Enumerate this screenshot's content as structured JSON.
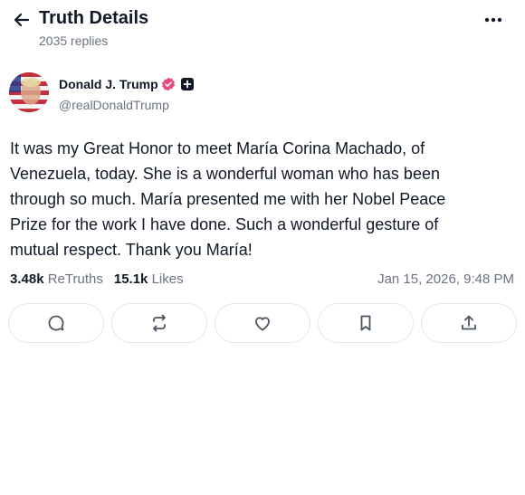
{
  "header": {
    "title": "Truth Details",
    "replies_label": "2035 replies"
  },
  "post": {
    "author": {
      "name": "Donald J. Trump",
      "handle": "@realDonaldTrump"
    },
    "text_lines": [
      "It was my Great Honor to meet María Corina Machado, of",
      "Venezuela, today. She is a wonderful woman who has been",
      "through so much. María presented me with her Nobel Peace",
      "Prize for the work I have done. Such a wonderful gesture of",
      "mutual respect. Thank you María!"
    ],
    "stats": {
      "retruths_count": "3.48k",
      "retruths_label": "ReTruths",
      "likes_count": "15.1k",
      "likes_label": "Likes"
    },
    "timestamp": "Jan 15, 2026, 9:48 PM"
  },
  "actions": [
    {
      "name": "reply",
      "icon": "comment-icon"
    },
    {
      "name": "retruth",
      "icon": "repost-icon"
    },
    {
      "name": "like",
      "icon": "heart-icon"
    },
    {
      "name": "bookmark",
      "icon": "bookmark-icon"
    },
    {
      "name": "share",
      "icon": "share-icon"
    }
  ],
  "colors": {
    "verified_badge": "#e5487b",
    "text_primary": "#111827",
    "text_secondary": "#6b7280",
    "border": "#e5e7eb"
  }
}
